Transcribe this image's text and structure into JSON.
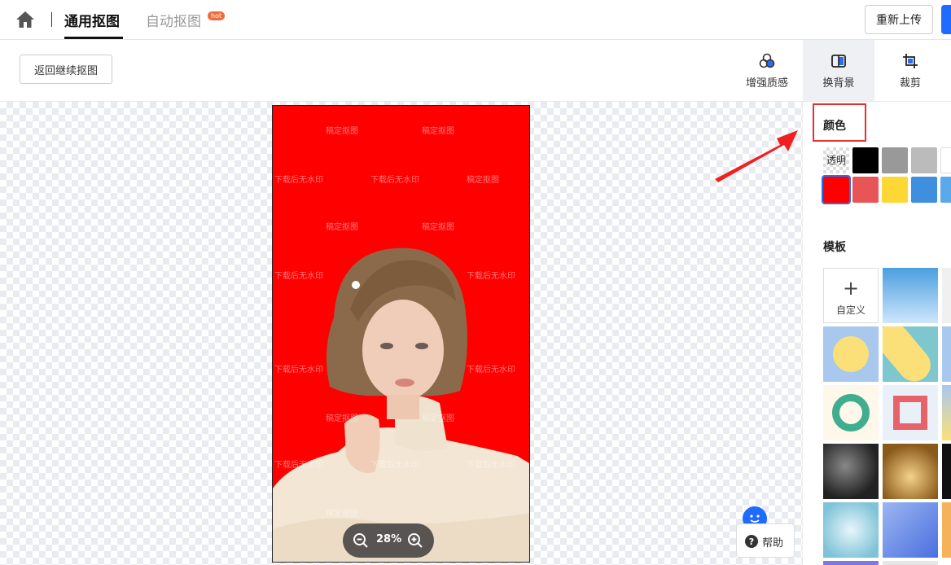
{
  "header": {
    "tab_active": "通用抠图",
    "tab_auto": "自动抠图",
    "hot_badge": "hot",
    "reupload": "重新上传"
  },
  "toolbar": {
    "back": "返回继续抠图",
    "tools": [
      {
        "label": "增强质感",
        "icon": "enhance-icon"
      },
      {
        "label": "换背景",
        "icon": "background-icon",
        "active": true
      },
      {
        "label": "裁剪",
        "icon": "crop-icon"
      }
    ]
  },
  "canvas": {
    "background_color": "#ff0000",
    "watermark_a": "稿定抠图",
    "watermark_b": "下载后无水印",
    "zoom": "28%"
  },
  "help": "帮助",
  "panel": {
    "color_title": "颜色",
    "transparent_label": "透明",
    "colors": [
      "#000000",
      "#999999",
      "#bbbbbb",
      "#ffffff",
      "#ff0000",
      "#e85555",
      "#fdd835",
      "#3f8fdf",
      "#5aa9ea"
    ],
    "template_title": "模板",
    "custom_label": "自定义"
  }
}
